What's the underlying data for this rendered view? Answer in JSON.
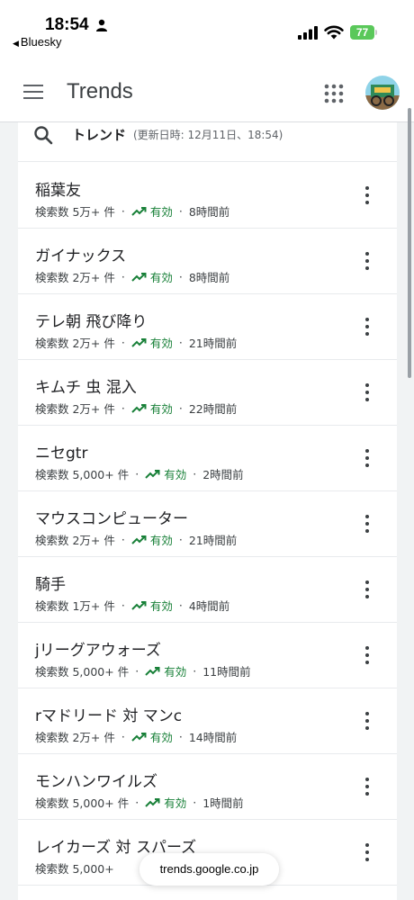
{
  "status_bar": {
    "time": "18:54",
    "back_app": "Bluesky",
    "battery_percent": "77"
  },
  "app_bar": {
    "title": "Trends"
  },
  "list_header": {
    "title": "トレンド",
    "subtitle": "(更新日時: 12月11日、18:54)"
  },
  "items": [
    {
      "term": "稲葉友",
      "volume": "検索数 5万+ 件",
      "status": "有効",
      "age": "8時間前"
    },
    {
      "term": "ガイナックス",
      "volume": "検索数 2万+ 件",
      "status": "有効",
      "age": "8時間前"
    },
    {
      "term": "テレ朝 飛び降り",
      "volume": "検索数 2万+ 件",
      "status": "有効",
      "age": "21時間前"
    },
    {
      "term": "キムチ 虫 混入",
      "volume": "検索数 2万+ 件",
      "status": "有効",
      "age": "22時間前"
    },
    {
      "term": "ニセgtr",
      "volume": "検索数 5,000+ 件",
      "status": "有効",
      "age": "2時間前"
    },
    {
      "term": "マウスコンピューター",
      "volume": "検索数 2万+ 件",
      "status": "有効",
      "age": "21時間前"
    },
    {
      "term": "騎手",
      "volume": "検索数 1万+ 件",
      "status": "有効",
      "age": "4時間前"
    },
    {
      "term": "jリーグアウォーズ",
      "volume": "検索数 5,000+ 件",
      "status": "有効",
      "age": "11時間前"
    },
    {
      "term": "rマドリード 対 マンc",
      "volume": "検索数 2万+ 件",
      "status": "有効",
      "age": "14時間前"
    },
    {
      "term": "モンハンワイルズ",
      "volume": "検索数 5,000+ 件",
      "status": "有効",
      "age": "1時間前"
    },
    {
      "term": "レイカーズ 対 スパーズ",
      "volume": "検索数 5,000+",
      "status": "",
      "age": ""
    }
  ],
  "url_bar": {
    "url": "trends.google.co.jp"
  },
  "colors": {
    "active_green": "#188038",
    "battery_green": "#5ac85a",
    "background": "#f1f3f4"
  },
  "icons": [
    "person-icon",
    "signal-icon",
    "wifi-icon",
    "battery-icon",
    "menu-icon",
    "apps-grid-icon",
    "avatar",
    "search-icon",
    "trending-up-icon",
    "more-vert-icon"
  ]
}
